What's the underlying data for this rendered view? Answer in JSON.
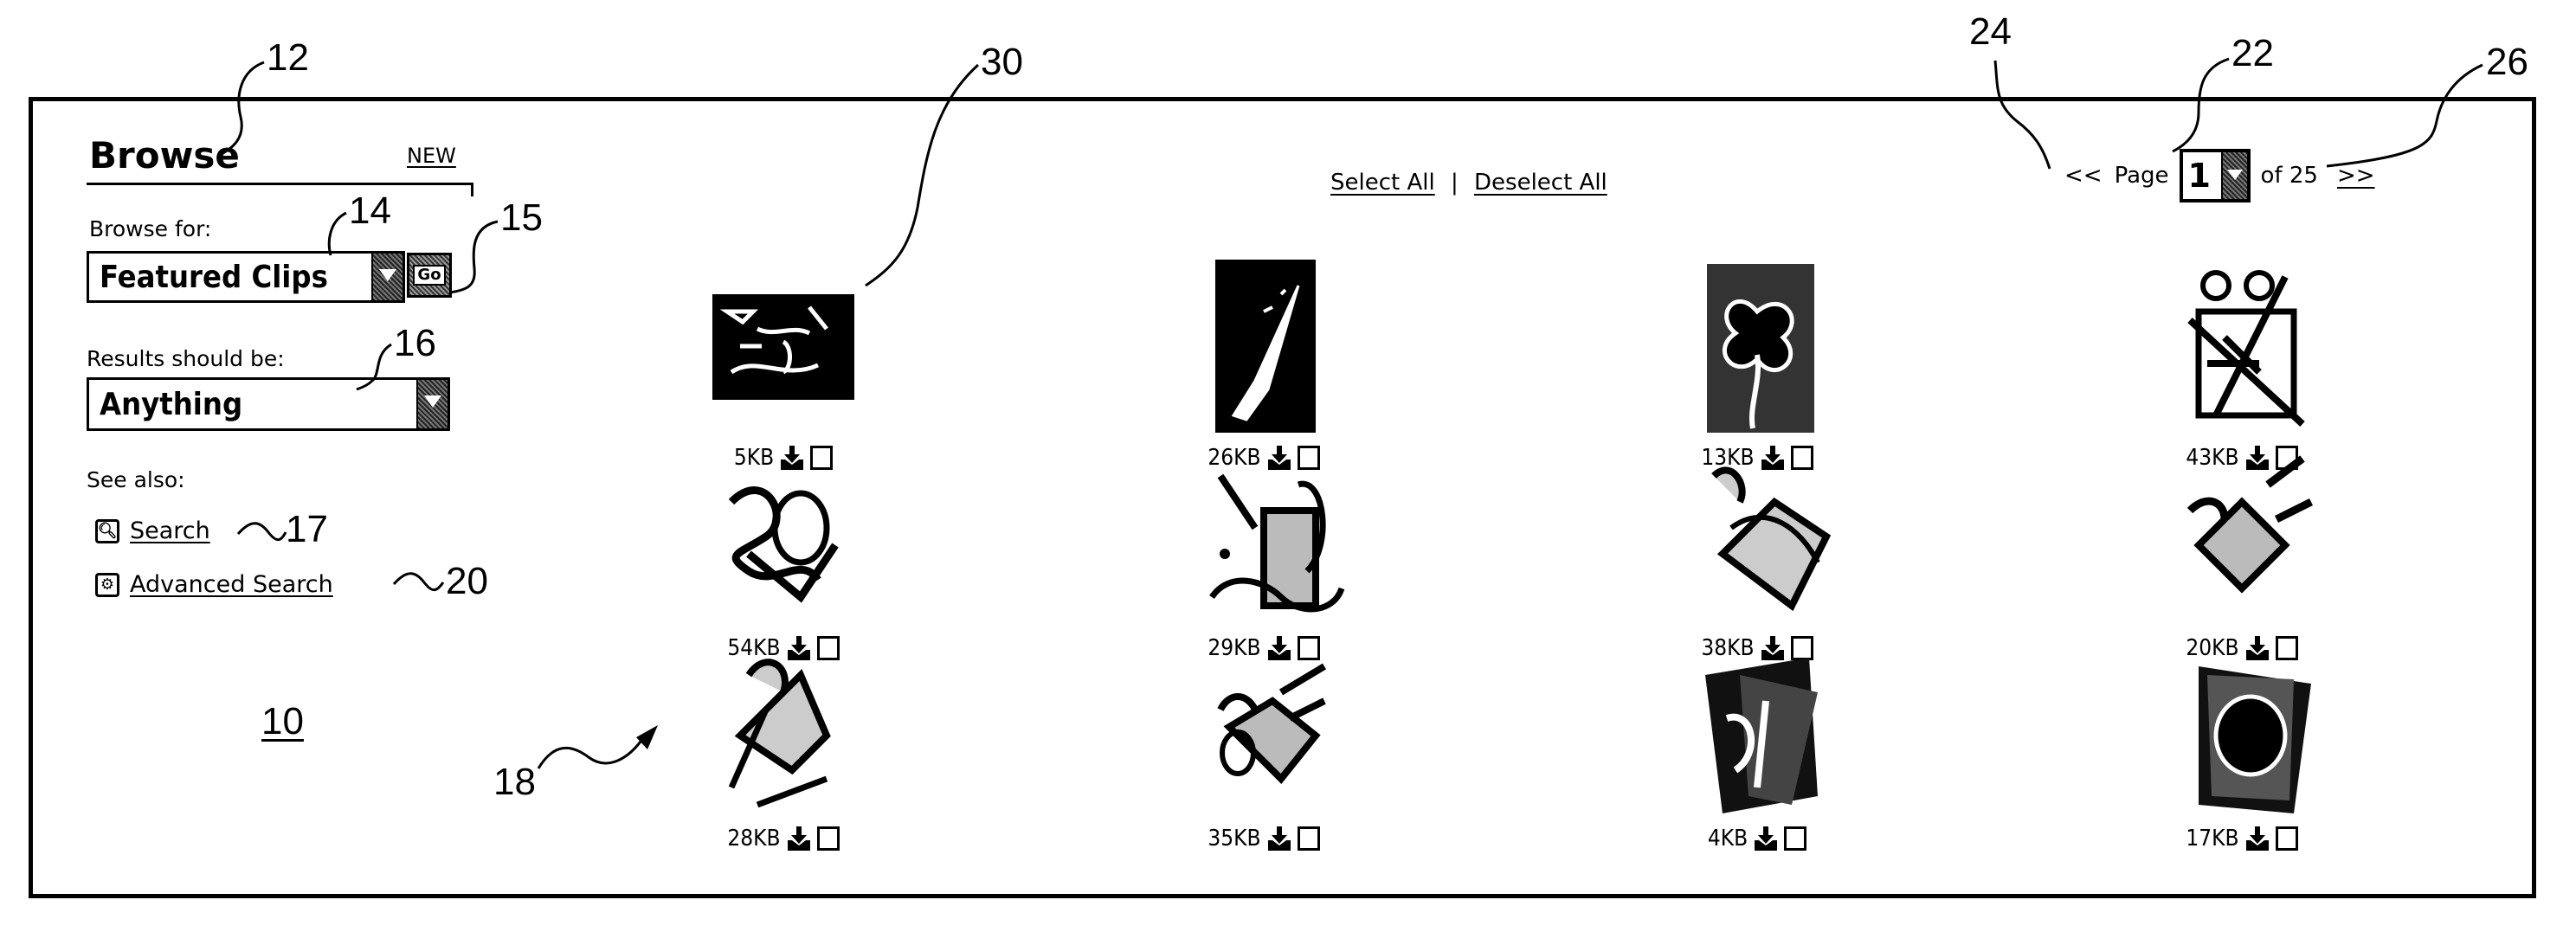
{
  "sidebar": {
    "title": "Browse",
    "new_link": "NEW",
    "browse_for_label": "Browse for:",
    "browse_for_value": "Featured Clips",
    "go_button": "Go",
    "results_label": "Results should be:",
    "results_value": "Anything",
    "see_also_label": "See also:",
    "links": [
      {
        "label": "Search",
        "icon": "search-icon"
      },
      {
        "label": "Advanced Search",
        "icon": "advanced-search-icon"
      }
    ]
  },
  "toolbar": {
    "select_all": "Select All",
    "separator": "|",
    "deselect_all": "Deselect All"
  },
  "pagination": {
    "prev": "<<",
    "page_label": "Page",
    "current_page": "1",
    "of_label": "of 25",
    "total_pages": 25,
    "next": ">>"
  },
  "clips": [
    {
      "size": "5KB",
      "art": "landscape-photo",
      "selected": false
    },
    {
      "size": "26KB",
      "art": "paintbrush-photo",
      "selected": false
    },
    {
      "size": "13KB",
      "art": "clover-photo",
      "selected": false
    },
    {
      "size": "43KB",
      "art": "gardening-clipart",
      "selected": false
    },
    {
      "size": "54KB",
      "art": "garden-hose-clipart",
      "selected": false
    },
    {
      "size": "29KB",
      "art": "watering-can-clipart",
      "selected": false
    },
    {
      "size": "38KB",
      "art": "flower-pot-clipart",
      "selected": false
    },
    {
      "size": "20KB",
      "art": "garden-tools-clipart",
      "selected": false
    },
    {
      "size": "28KB",
      "art": "seed-packet-clipart",
      "selected": false
    },
    {
      "size": "35KB",
      "art": "planting-clipart",
      "selected": false
    },
    {
      "size": "4KB",
      "art": "card-photo",
      "selected": false
    },
    {
      "size": "17KB",
      "art": "frame-photo",
      "selected": false
    }
  ],
  "reference_numerals": {
    "r10": "10",
    "r12": "12",
    "r14": "14",
    "r15": "15",
    "r16": "16",
    "r17": "17",
    "r18": "18",
    "r20": "20",
    "r22": "22",
    "r24": "24",
    "r26": "26",
    "r30": "30"
  }
}
